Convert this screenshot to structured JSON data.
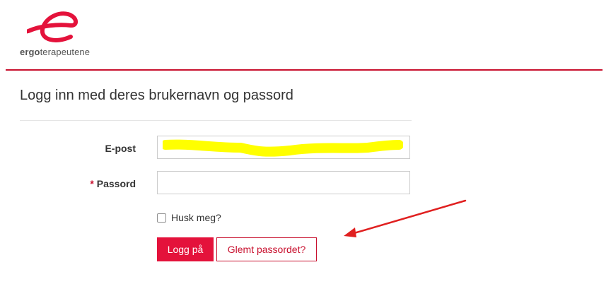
{
  "header": {
    "logo_bold": "ergo",
    "logo_rest": "terapeutene",
    "logo_mark": "e",
    "accent_color": "#c8102e"
  },
  "main": {
    "title": "Logg inn med deres brukernavn og passord",
    "email": {
      "label": "E-post",
      "value": ""
    },
    "password": {
      "required_mark": "*",
      "label": "Passord",
      "value": ""
    },
    "remember": {
      "label": "Husk meg?",
      "checked": false
    },
    "login_button": "Logg på",
    "forgot_button": "Glemt passordet?"
  },
  "annotation": {
    "arrow_color": "#e02020",
    "highlight_color": "#ffff00"
  }
}
